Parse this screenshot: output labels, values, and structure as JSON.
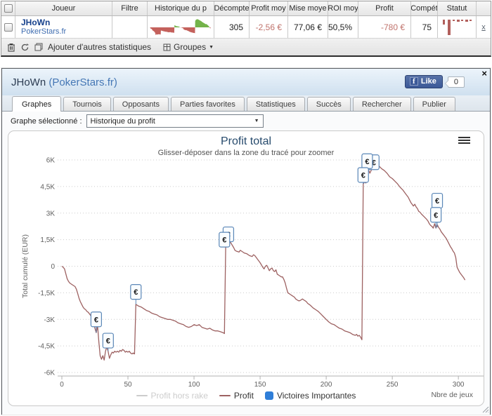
{
  "stats_table": {
    "columns": [
      {
        "label": ""
      },
      {
        "label": "Joueur"
      },
      {
        "label": "Filtre"
      },
      {
        "label": "Historique du p"
      },
      {
        "label": "Décompte"
      },
      {
        "label": "Profit moy"
      },
      {
        "label": "Mise moye"
      },
      {
        "label": "ROI moy"
      },
      {
        "label": "Profit"
      },
      {
        "label": "Compét"
      },
      {
        "label": "Statut"
      },
      {
        "label": ""
      }
    ],
    "row": {
      "player": "JHoWn",
      "site": "PokerStars.fr",
      "filtre": "",
      "decompte": "305",
      "profit_moy": "-2,56 €",
      "mise_moy": "77,06 €",
      "roi_moy": "50,5%",
      "profit": "-780 €",
      "compet": "75",
      "remove_link": "x"
    },
    "history_spark": {
      "neg_color": "#c4615c",
      "pos_color": "#74b34a"
    },
    "statut_spark": {
      "color": "#b2605c",
      "bars": [
        [
          3,
          3,
          7
        ],
        [
          10,
          4,
          22
        ],
        [
          17,
          3,
          2
        ],
        [
          23,
          4,
          3
        ],
        [
          29,
          3,
          2
        ],
        [
          35,
          4,
          3
        ],
        [
          41,
          3,
          2
        ]
      ]
    },
    "toolbar": {
      "add_stats_label": "Ajouter d'autres statistiques",
      "groups_label": "Groupes",
      "caret": "▼"
    }
  },
  "window": {
    "title_player": "JHoWn ",
    "title_site": "(PokerStars.fr)",
    "close_label": "×",
    "facebook": {
      "f_glyph": "f",
      "like_label": "Like",
      "count": "0"
    },
    "tabs": [
      "Graphes",
      "Tournois",
      "Opposants",
      "Parties favorites",
      "Statistiques",
      "Succès",
      "Rechercher",
      "Publier"
    ],
    "active_tab": "Graphes",
    "selector_label": "Graphe sélectionné :",
    "selector_value": "Historique du profit",
    "selector_caret": "▼"
  },
  "chart_data": {
    "type": "line",
    "title": "Profit total",
    "subtitle": "Glisser-déposer dans la zone du tracé pour zoomer",
    "ylabel": "Total cumulé (EUR)",
    "xlabel": "Nbre de jeux",
    "xlim": [
      0,
      318
    ],
    "ylim": [
      -6000,
      6000
    ],
    "grid": "dotted",
    "legend_position": "bottom",
    "yticks": [
      {
        "value": 6000,
        "label": "6K"
      },
      {
        "value": 4500,
        "label": "4,5K"
      },
      {
        "value": 3000,
        "label": "3K"
      },
      {
        "value": 1500,
        "label": "1,5K"
      },
      {
        "value": 0,
        "label": "0"
      },
      {
        "value": -1500,
        "label": "-1,5K"
      },
      {
        "value": -3000,
        "label": "-3K"
      },
      {
        "value": -4500,
        "label": "-4,5K"
      },
      {
        "value": -6000,
        "label": "-6K"
      }
    ],
    "xticks": [
      "0",
      "50",
      "100",
      "150",
      "200",
      "250",
      "300"
    ],
    "series": [
      {
        "name": "Profit hors rake",
        "color": "#cccccc",
        "disabled": true,
        "points": []
      },
      {
        "name": "Profit",
        "color": "#9d6161",
        "disabled": false,
        "points": [
          [
            0,
            0
          ],
          [
            1,
            -60
          ],
          [
            2,
            -150
          ],
          [
            3,
            -420
          ],
          [
            4,
            -700
          ],
          [
            5,
            -850
          ],
          [
            6,
            -950
          ],
          [
            8,
            -1050
          ],
          [
            10,
            -1150
          ],
          [
            11,
            -1300
          ],
          [
            12,
            -1550
          ],
          [
            13,
            -1800
          ],
          [
            14,
            -2000
          ],
          [
            15,
            -2150
          ],
          [
            16,
            -2300
          ],
          [
            17,
            -2400
          ],
          [
            18,
            -2450
          ],
          [
            19,
            -2550
          ],
          [
            20,
            -2600
          ],
          [
            21,
            -2700
          ],
          [
            22,
            -2800
          ],
          [
            23,
            -2950
          ],
          [
            24,
            -3200
          ],
          [
            25,
            -3500
          ],
          [
            26,
            -3750
          ],
          [
            27,
            -3350
          ],
          [
            28,
            -4300
          ],
          [
            29,
            -5050
          ],
          [
            30,
            -5250
          ],
          [
            31,
            -5050
          ],
          [
            32,
            -5300
          ],
          [
            33,
            -4800
          ],
          [
            34,
            -4550
          ],
          [
            35,
            -4800
          ],
          [
            36,
            -5200
          ],
          [
            37,
            -5000
          ],
          [
            38,
            -4850
          ],
          [
            39,
            -4900
          ],
          [
            40,
            -4800
          ],
          [
            41,
            -4850
          ],
          [
            42,
            -4800
          ],
          [
            43,
            -4850
          ],
          [
            44,
            -4750
          ],
          [
            45,
            -4800
          ],
          [
            46,
            -4700
          ],
          [
            47,
            -4750
          ],
          [
            48,
            -4850
          ],
          [
            49,
            -4800
          ],
          [
            50,
            -4850
          ],
          [
            51,
            -4800
          ],
          [
            52,
            -4900
          ],
          [
            53,
            -4950
          ],
          [
            54,
            -4900
          ],
          [
            55,
            -4950
          ],
          [
            56,
            -2150
          ],
          [
            57,
            -2200
          ],
          [
            58,
            -2250
          ],
          [
            60,
            -2300
          ],
          [
            62,
            -2400
          ],
          [
            64,
            -2500
          ],
          [
            66,
            -2550
          ],
          [
            68,
            -2650
          ],
          [
            70,
            -2700
          ],
          [
            72,
            -2750
          ],
          [
            74,
            -2850
          ],
          [
            76,
            -2900
          ],
          [
            78,
            -2950
          ],
          [
            80,
            -3000
          ],
          [
            82,
            -3000
          ],
          [
            84,
            -3050
          ],
          [
            86,
            -3100
          ],
          [
            88,
            -3200
          ],
          [
            90,
            -3250
          ],
          [
            92,
            -3300
          ],
          [
            94,
            -3400
          ],
          [
            96,
            -3450
          ],
          [
            98,
            -3400
          ],
          [
            100,
            -3300
          ],
          [
            102,
            -3350
          ],
          [
            104,
            -3300
          ],
          [
            106,
            -3450
          ],
          [
            108,
            -3500
          ],
          [
            110,
            -3550
          ],
          [
            112,
            -3500
          ],
          [
            114,
            -3600
          ],
          [
            116,
            -3650
          ],
          [
            118,
            -3650
          ],
          [
            120,
            -3700
          ],
          [
            122,
            -3750
          ],
          [
            123,
            -3800
          ],
          [
            124,
            1350
          ],
          [
            125,
            1400
          ],
          [
            126,
            1450
          ],
          [
            127,
            1400
          ],
          [
            128,
            1300
          ],
          [
            130,
            1050
          ],
          [
            131,
            900
          ],
          [
            132,
            850
          ],
          [
            134,
            800
          ],
          [
            135,
            900
          ],
          [
            136,
            850
          ],
          [
            138,
            750
          ],
          [
            140,
            700
          ],
          [
            142,
            600
          ],
          [
            144,
            550
          ],
          [
            145,
            650
          ],
          [
            146,
            600
          ],
          [
            148,
            400
          ],
          [
            150,
            200
          ],
          [
            152,
            -50
          ],
          [
            153,
            -150
          ],
          [
            154,
            0
          ],
          [
            155,
            50
          ],
          [
            156,
            -100
          ],
          [
            157,
            -250
          ],
          [
            158,
            -150
          ],
          [
            159,
            -100
          ],
          [
            160,
            -250
          ],
          [
            161,
            -300
          ],
          [
            162,
            -200
          ],
          [
            163,
            -450
          ],
          [
            164,
            -500
          ],
          [
            165,
            -550
          ],
          [
            166,
            -600
          ],
          [
            167,
            -600
          ],
          [
            168,
            -750
          ],
          [
            169,
            -950
          ],
          [
            170,
            -1250
          ],
          [
            171,
            -1500
          ],
          [
            172,
            -1550
          ],
          [
            173,
            -1600
          ],
          [
            174,
            -1650
          ],
          [
            175,
            -1700
          ],
          [
            176,
            -1750
          ],
          [
            177,
            -1850
          ],
          [
            178,
            -1900
          ],
          [
            179,
            -1950
          ],
          [
            180,
            -1950
          ],
          [
            181,
            -1900
          ],
          [
            182,
            -1850
          ],
          [
            183,
            -1900
          ],
          [
            184,
            -1950
          ],
          [
            185,
            -2000
          ],
          [
            186,
            -2100
          ],
          [
            187,
            -2150
          ],
          [
            188,
            -2200
          ],
          [
            190,
            -2350
          ],
          [
            192,
            -2450
          ],
          [
            194,
            -2550
          ],
          [
            196,
            -2700
          ],
          [
            198,
            -2850
          ],
          [
            200,
            -3000
          ],
          [
            202,
            -3150
          ],
          [
            204,
            -3250
          ],
          [
            206,
            -3300
          ],
          [
            208,
            -3400
          ],
          [
            210,
            -3500
          ],
          [
            212,
            -3550
          ],
          [
            214,
            -3650
          ],
          [
            216,
            -3700
          ],
          [
            218,
            -3750
          ],
          [
            220,
            -3850
          ],
          [
            222,
            -3900
          ],
          [
            223,
            -3850
          ],
          [
            224,
            -3950
          ],
          [
            225,
            -3900
          ],
          [
            226,
            -4000
          ],
          [
            227,
            -4150
          ],
          [
            228,
            4650
          ],
          [
            229,
            4750
          ],
          [
            230,
            4700
          ],
          [
            231,
            5000
          ],
          [
            232,
            5450
          ],
          [
            233,
            5250
          ],
          [
            234,
            5400
          ],
          [
            235,
            5550
          ],
          [
            236,
            5500
          ],
          [
            237,
            5600
          ],
          [
            238,
            5650
          ],
          [
            239,
            5600
          ],
          [
            240,
            5650
          ],
          [
            242,
            5500
          ],
          [
            244,
            5400
          ],
          [
            246,
            5250
          ],
          [
            248,
            5050
          ],
          [
            250,
            4950
          ],
          [
            252,
            4800
          ],
          [
            254,
            4650
          ],
          [
            256,
            4450
          ],
          [
            258,
            4300
          ],
          [
            260,
            4100
          ],
          [
            262,
            3900
          ],
          [
            263,
            3750
          ],
          [
            264,
            3600
          ],
          [
            265,
            3500
          ],
          [
            266,
            3400
          ],
          [
            267,
            3500
          ],
          [
            268,
            3350
          ],
          [
            269,
            3250
          ],
          [
            270,
            3100
          ],
          [
            271,
            3050
          ],
          [
            272,
            2950
          ],
          [
            274,
            2800
          ],
          [
            276,
            2650
          ],
          [
            277,
            2550
          ],
          [
            278,
            2400
          ],
          [
            279,
            2300
          ],
          [
            280,
            2250
          ],
          [
            281,
            2150
          ],
          [
            282,
            2400
          ],
          [
            283,
            2150
          ],
          [
            284,
            2350
          ],
          [
            285,
            2200
          ],
          [
            286,
            2100
          ],
          [
            287,
            1950
          ],
          [
            288,
            1850
          ],
          [
            289,
            1750
          ],
          [
            290,
            1650
          ],
          [
            291,
            1550
          ],
          [
            292,
            1400
          ],
          [
            293,
            1250
          ],
          [
            294,
            1100
          ],
          [
            295,
            1000
          ],
          [
            296,
            850
          ],
          [
            297,
            750
          ],
          [
            298,
            500
          ],
          [
            299,
            -50
          ],
          [
            300,
            -200
          ],
          [
            301,
            -350
          ],
          [
            302,
            -450
          ],
          [
            303,
            -550
          ],
          [
            304,
            -650
          ],
          [
            305,
            -780
          ]
        ]
      }
    ],
    "flags": {
      "name": "Victoires Importantes",
      "symbol": "€",
      "color": "#2f7ed8",
      "box_border": "#5b87b7",
      "box_fill": "#fafdff",
      "items": [
        {
          "x": 126,
          "value": 1800,
          "anchor": 1400
        },
        {
          "x": 123,
          "value": 1500,
          "anchor": 1350
        },
        {
          "x": 236,
          "value": 5870,
          "anchor": 5550
        },
        {
          "x": 231,
          "value": 5930,
          "anchor": 5400
        },
        {
          "x": 228,
          "value": 5150,
          "anchor": 4650
        },
        {
          "x": 26,
          "value": -3000,
          "anchor": -3750
        },
        {
          "x": 35,
          "value": -4200,
          "anchor": -4800
        },
        {
          "x": 56,
          "value": -1450,
          "anchor": -2150
        },
        {
          "x": 284,
          "value": 3700,
          "anchor": 2200
        },
        {
          "x": 283,
          "value": 2900,
          "anchor": 2150
        }
      ]
    }
  }
}
